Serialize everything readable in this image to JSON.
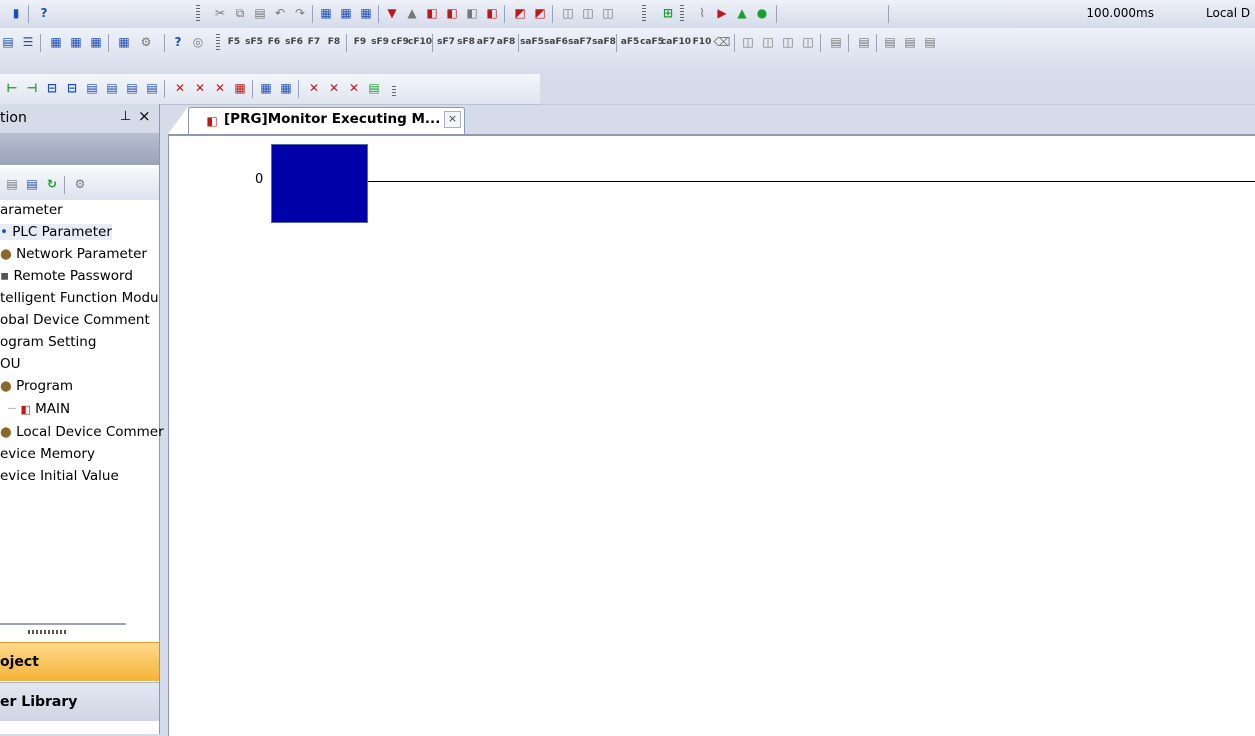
{
  "toolbar": {
    "scan_time": "100.000ms",
    "local_label": "Local D"
  },
  "navigation": {
    "title": "tion",
    "pin_glyph": "⊥",
    "close_glyph": "×",
    "tree": [
      "arameter",
      "PLC Parameter",
      "Network Parameter",
      "Remote Password",
      "telligent Function Modu",
      "obal Device Comment",
      "ogram Setting",
      "OU",
      "Program",
      "MAIN",
      "Local Device Commer",
      "evice Memory",
      "evice Initial Value"
    ],
    "bottom_tabs": [
      "oject",
      "er Library"
    ]
  },
  "editor": {
    "tab_label": "[PRG]Monitor Executing M...",
    "tab_close": "×",
    "step_number": "0"
  }
}
